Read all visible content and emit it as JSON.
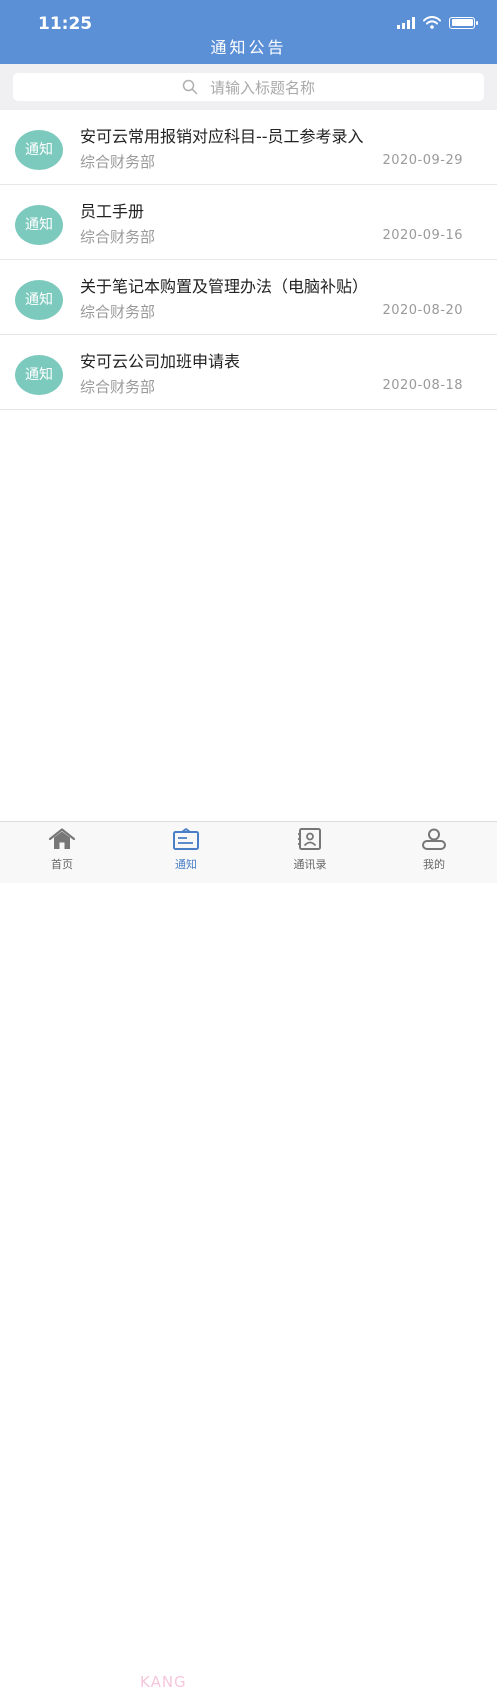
{
  "status_bar": {
    "time": "11:25"
  },
  "header": {
    "title": "通知公告"
  },
  "search": {
    "placeholder": "请输入标题名称"
  },
  "notices": [
    {
      "badge": "通知",
      "title": "安可云常用报销对应科目--员工参考录入",
      "dept": "综合财务部",
      "date": "2020-09-29"
    },
    {
      "badge": "通知",
      "title": "员工手册",
      "dept": "综合财务部",
      "date": "2020-09-16"
    },
    {
      "badge": "通知",
      "title": "关于笔记本购置及管理办法（电脑补贴）",
      "dept": "综合财务部",
      "date": "2020-08-20"
    },
    {
      "badge": "通知",
      "title": "安可云公司加班申请表",
      "dept": "综合财务部",
      "date": "2020-08-18"
    }
  ],
  "tabs": [
    {
      "label": "首页",
      "icon": "home-icon"
    },
    {
      "label": "通知",
      "icon": "notice-icon",
      "active": true
    },
    {
      "label": "通讯录",
      "icon": "contacts-icon"
    },
    {
      "label": "我的",
      "icon": "user-icon"
    }
  ],
  "watermark": "KANG",
  "colors": {
    "header": "#5b8fd6",
    "badge": "#7cc9bd",
    "tab_active": "#4a7fc7"
  }
}
